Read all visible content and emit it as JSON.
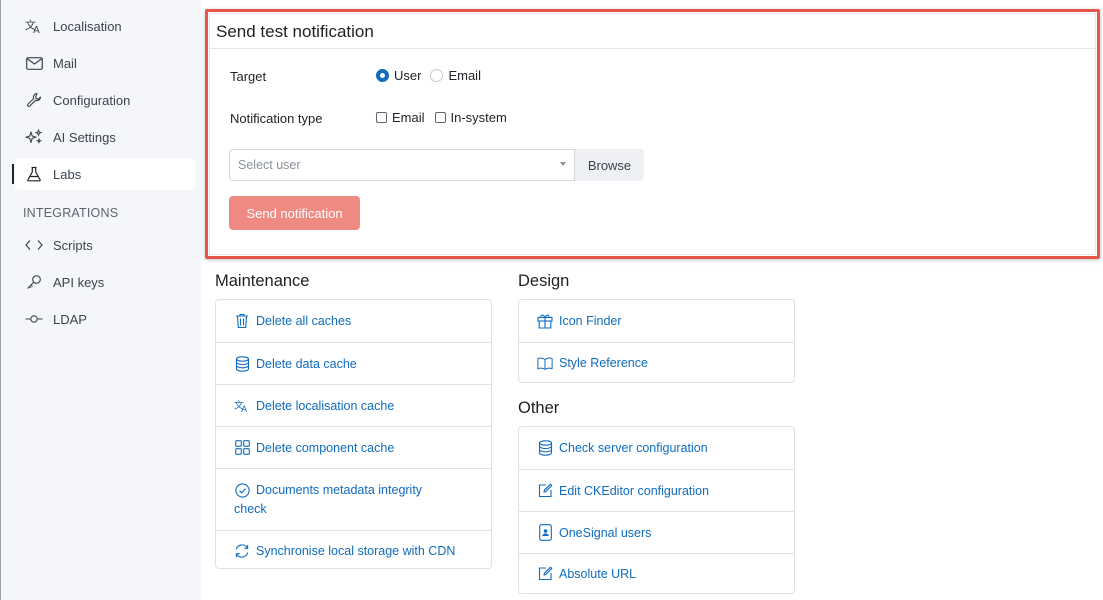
{
  "sidebar": {
    "items": [
      {
        "label": "Localisation",
        "icon": "translate-icon"
      },
      {
        "label": "Mail",
        "icon": "mail-icon"
      },
      {
        "label": "Configuration",
        "icon": "wrench-icon"
      },
      {
        "label": "AI Settings",
        "icon": "sparkles-icon"
      },
      {
        "label": "Labs",
        "icon": "flask-icon",
        "active": true
      }
    ],
    "heading": "INTEGRATIONS",
    "integrations": [
      {
        "label": "Scripts",
        "icon": "code-icon"
      },
      {
        "label": "API keys",
        "icon": "key-icon"
      },
      {
        "label": "LDAP",
        "icon": "ldap-icon"
      }
    ]
  },
  "notification_card": {
    "title": "Send test notification",
    "target_label": "Target",
    "target_options": [
      "User",
      "Email"
    ],
    "target_selected": "User",
    "type_label": "Notification type",
    "type_options": [
      "Email",
      "In-system"
    ],
    "select_placeholder": "Select user",
    "browse_label": "Browse",
    "send_label": "Send notification"
  },
  "maintenance": {
    "title": "Maintenance",
    "items": [
      {
        "label": "Delete all caches",
        "icon": "trash-icon"
      },
      {
        "label": "Delete data cache",
        "icon": "database-icon"
      },
      {
        "label": "Delete localisation cache",
        "icon": "translate-icon"
      },
      {
        "label": "Delete component cache",
        "icon": "grid-icon"
      },
      {
        "label_line1": "Documents metadata integrity",
        "label_line2": "check",
        "icon": "check-circle-icon"
      },
      {
        "label": "Synchronise local storage with CDN",
        "icon": "sync-icon"
      }
    ]
  },
  "design": {
    "title": "Design",
    "items": [
      {
        "label": "Icon Finder",
        "icon": "gift-icon"
      },
      {
        "label": "Style Reference",
        "icon": "book-icon"
      }
    ]
  },
  "other": {
    "title": "Other",
    "items": [
      {
        "label": "Check server configuration",
        "icon": "database-icon"
      },
      {
        "label": "Edit CKEditor configuration",
        "icon": "edit-icon"
      },
      {
        "label": "OneSignal users",
        "icon": "phone-user-icon"
      },
      {
        "label": "Absolute URL",
        "icon": "edit-icon"
      }
    ]
  },
  "colors": {
    "link": "#0f6cbf",
    "highlight": "#e4574a",
    "send_button": "#ef8a82",
    "sidebar_bg": "#f4f6f9"
  }
}
